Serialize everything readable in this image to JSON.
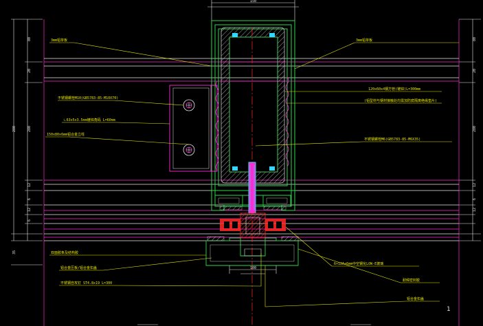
{
  "colors": {
    "background": "#000000",
    "dimension": "#e8e8e8",
    "magenta": "#ff2bd6",
    "green": "#27d84a",
    "yellow_leader": "#e8e800",
    "red": "#ff2a2a",
    "cyan": "#34d7ff",
    "hatch": "#c4c4c4"
  },
  "page_number": "1",
  "labels": {
    "top_left": "3mm铝单板",
    "top_right": "3mm铝单板",
    "bolt_spec": "不锈钢螺栓M10(GB5783-85-M10X70)",
    "angle_spec": "ㄴ63x5x3.5mm镀锌角码 L=60mm",
    "tube_spec": "150x80x6mm铝合金立柱",
    "r1": "120x60x4钢方管(镀锌)L=300mm",
    "r2": "(铝型材与钢材接触处均需加防腐隔离绝缘垫片)",
    "r3": "不锈钢螺栓M6(GB5783-85-M6X35)",
    "b1": "双面胶条及结构胶",
    "b2": "铝合金压板/铝合金扣盖",
    "b3": "6+12A+6mm中空钢化LOW-E玻璃",
    "b4": "耐候密封胶",
    "b5": "不锈钢自攻钉 ST4.8x19 L=300",
    "b6": "铝合金扣盖"
  },
  "dimensions": {
    "top": "150",
    "left_top": "80",
    "left_a": "20",
    "left_total": "280",
    "left_b": "12",
    "left_c": "6",
    "left_bottom": "12",
    "left_lower": "35",
    "right_top": "80",
    "right_a": "20",
    "right_total": "280",
    "right_b": "12",
    "right_c": "6",
    "right_bottom": "12",
    "bottom": "100",
    "bottom_small": "50"
  }
}
